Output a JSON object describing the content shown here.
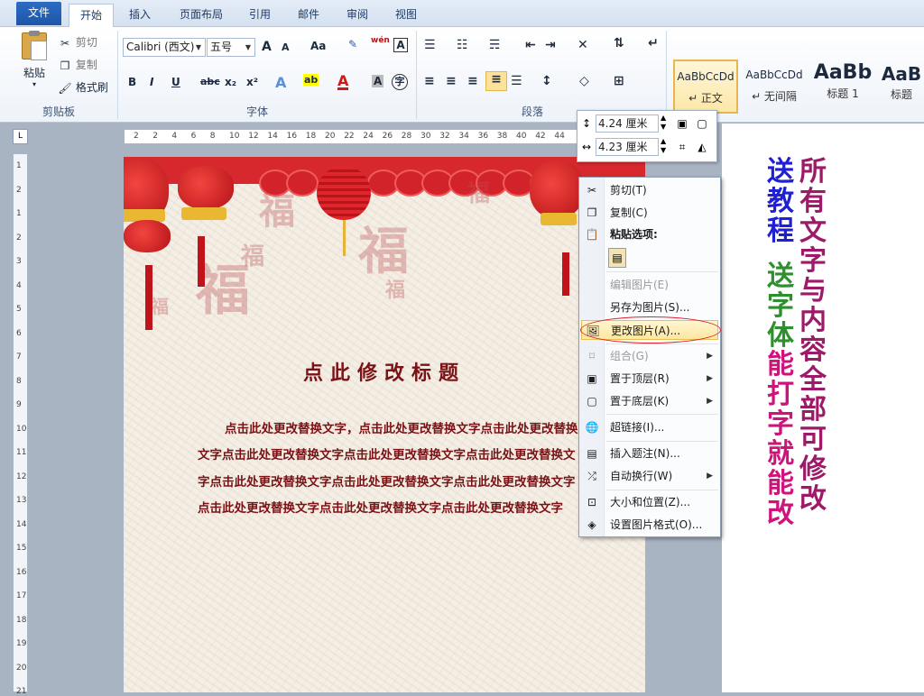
{
  "tabs": [
    {
      "label": "文件"
    },
    {
      "label": "开始"
    },
    {
      "label": "插入"
    },
    {
      "label": "页面布局"
    },
    {
      "label": "引用"
    },
    {
      "label": "邮件"
    },
    {
      "label": "审阅"
    },
    {
      "label": "视图"
    }
  ],
  "clipboard": {
    "paste": "粘贴",
    "cut": "剪切",
    "copy": "复制",
    "format_painter": "格式刷",
    "group": "剪贴板"
  },
  "font": {
    "name": "Calibri (西文)",
    "size": "五号",
    "group": "字体",
    "bold": "B",
    "italic": "I",
    "underline": "U",
    "strike": "abc",
    "sub": "x₂",
    "sup": "x²",
    "grow": "A",
    "shrink": "A",
    "case": "Aa",
    "wen": "wén"
  },
  "paragraph": {
    "group": "段落"
  },
  "styles": [
    {
      "sample": "AaBbCcDd",
      "name": "↵ 正文"
    },
    {
      "sample": "AaBbCcDd",
      "name": "↵ 无间隔"
    },
    {
      "sample": "AaBb",
      "name": "标题 1"
    },
    {
      "sample": "AaB",
      "name": "标题"
    }
  ],
  "size_toolbar": {
    "height": "4.24 厘米",
    "width": "4.23 厘米"
  },
  "hruler_labels": [
    "2",
    "2",
    "4",
    "6",
    "8",
    "10",
    "12",
    "14",
    "16",
    "18",
    "20",
    "22",
    "24",
    "26",
    "28",
    "30",
    "32",
    "34",
    "36",
    "38",
    "40",
    "42",
    "44"
  ],
  "vruler_labels": [
    "1",
    "2",
    "1",
    "2",
    "3",
    "4",
    "5",
    "6",
    "7",
    "8",
    "9",
    "10",
    "11",
    "12",
    "13",
    "14",
    "15",
    "16",
    "17",
    "18",
    "19",
    "20",
    "21"
  ],
  "document": {
    "title": "点此修改标题",
    "paragraph": "点击此处更改替换文字，点击此处更改替换文字点击此处更改替换文字点击此处更改替换文字点击此处更改替换文字点击此处更改替换文字点击此处更改替换文字点击此处更改替换文字点击此处更改替换文字点击此处更改替换文字点击此处更改替换文字点击此处更改替换文字"
  },
  "context_menu": [
    {
      "label": "剪切(T)",
      "icon": "scissors-icon",
      "enabled": true
    },
    {
      "label": "复制(C)",
      "icon": "copy-icon",
      "enabled": true
    },
    {
      "label": "粘贴选项:",
      "icon": "paste-icon",
      "enabled": true,
      "bold": true
    },
    {
      "label": "编辑图片(E)",
      "icon": "",
      "enabled": false
    },
    {
      "label": "另存为图片(S)...",
      "icon": "",
      "enabled": true
    },
    {
      "label": "更改图片(A)...",
      "icon": "change-picture-icon",
      "enabled": true,
      "highlighted": true
    },
    {
      "label": "组合(G)",
      "icon": "group-icon",
      "enabled": false,
      "submenu": true
    },
    {
      "label": "置于顶层(R)",
      "icon": "bring-front-icon",
      "enabled": true,
      "submenu": true
    },
    {
      "label": "置于底层(K)",
      "icon": "send-back-icon",
      "enabled": true,
      "submenu": true
    },
    {
      "label": "超链接(I)...",
      "icon": "hyperlink-icon",
      "enabled": true
    },
    {
      "label": "插入题注(N)...",
      "icon": "caption-icon",
      "enabled": true
    },
    {
      "label": "自动换行(W)",
      "icon": "wrap-icon",
      "enabled": true,
      "submenu": true
    },
    {
      "label": "大小和位置(Z)...",
      "icon": "size-position-icon",
      "enabled": true
    },
    {
      "label": "设置图片格式(O)...",
      "icon": "format-picture-icon",
      "enabled": true
    }
  ],
  "promo": {
    "col1": "送教程",
    "col2": "送字体",
    "col3": "能打字就能改",
    "col4": "所有文字与内容全部可修改"
  },
  "colors": {
    "accent": "#2b6cc4",
    "title_red": "#7a1216",
    "promo_blue": "#1f1fd6",
    "promo_green": "#2e8f2e",
    "promo_magenta": "#d0137a",
    "promo_purple": "#9c1a67"
  }
}
